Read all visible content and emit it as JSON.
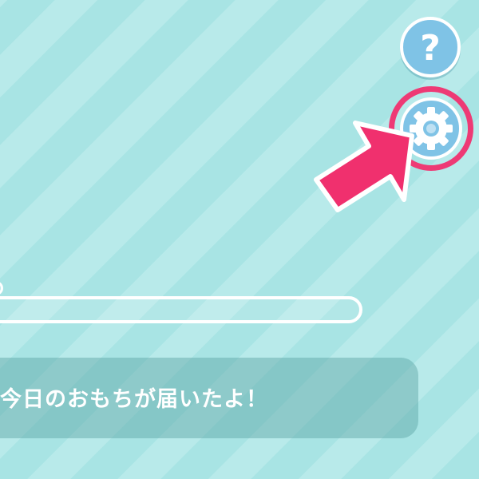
{
  "screen": {
    "background_color": "#a8e4e4",
    "stripe_color": "#b8eaea"
  },
  "help_button": {
    "icon": "question-mark-icon",
    "label": "?",
    "color": "#7fc3e6"
  },
  "settings_button": {
    "icon": "gear-icon",
    "color": "#7fc3e6",
    "highlight_ring_color": "#ee3a75"
  },
  "tutorial_pointer": {
    "icon": "pointer-arrow-icon",
    "color": "#f0306e"
  },
  "progress": {
    "value": 0
  },
  "message": {
    "text": "今日のおもちが届いたよ！"
  }
}
